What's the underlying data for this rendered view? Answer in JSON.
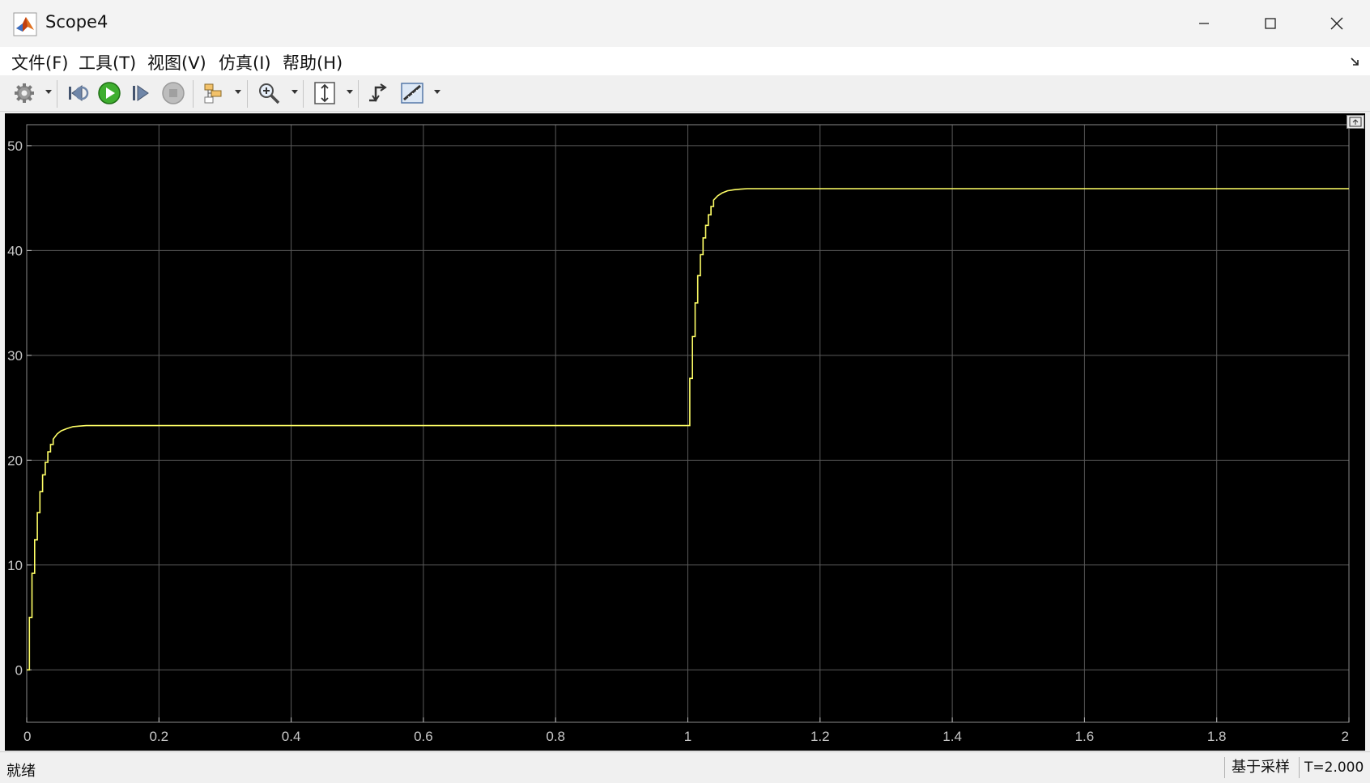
{
  "window": {
    "title": "Scope4",
    "menu": [
      "文件(F)",
      "工具(T)",
      "视图(V)",
      "仿真(I)",
      "帮助(H)"
    ]
  },
  "toolbar": {
    "icons": [
      "gear-icon",
      "step-back-icon",
      "run-icon",
      "step-forward-icon",
      "stop-icon",
      "signal-selector-icon",
      "zoom-icon",
      "autoscale-icon",
      "cursor-icon",
      "measurements-icon"
    ]
  },
  "status": {
    "text": "就绪",
    "sample_mode": "基于采样",
    "time": "T=2.000"
  },
  "colors": {
    "plot_background": "#000000",
    "axes_background": "#000000",
    "signal": "#ffff66",
    "grid": "#5a5a5a",
    "tick_text": "#c8c8c8"
  },
  "chart_data": {
    "type": "line",
    "xlim": [
      0,
      2
    ],
    "ylim": [
      -5,
      52
    ],
    "xticks": [
      "0",
      "0.2",
      "0.4",
      "0.6",
      "0.8",
      "1",
      "1.2",
      "1.4",
      "1.6",
      "1.8",
      "2"
    ],
    "xtick_values": [
      0,
      0.2,
      0.4,
      0.6,
      0.8,
      1,
      1.2,
      1.4,
      1.6,
      1.8,
      2
    ],
    "yticks": [
      "0",
      "10",
      "20",
      "30",
      "40",
      "50"
    ],
    "ytick_values": [
      0,
      10,
      20,
      30,
      40,
      50
    ],
    "grid": true,
    "series": [
      {
        "x": [
          0,
          0.004,
          0.004,
          0.008,
          0.008,
          0.012,
          0.012,
          0.016,
          0.016,
          0.02,
          0.02,
          0.024,
          0.024,
          0.028,
          0.028,
          0.032,
          0.032,
          0.036,
          0.036,
          0.04,
          0.04,
          0.046,
          0.052,
          0.06,
          0.07,
          0.08,
          0.09,
          0.1,
          1.003,
          1.003,
          1.007,
          1.007,
          1.011,
          1.011,
          1.015,
          1.015,
          1.019,
          1.019,
          1.023,
          1.023,
          1.027,
          1.027,
          1.031,
          1.031,
          1.035,
          1.035,
          1.039,
          1.039,
          1.045,
          1.052,
          1.06,
          1.07,
          1.08,
          1.09,
          1.1,
          2.0
        ],
        "y": [
          0,
          0,
          5.0,
          5.0,
          9.2,
          9.2,
          12.4,
          12.4,
          15.0,
          15.0,
          17.0,
          17.0,
          18.6,
          18.6,
          19.8,
          19.8,
          20.8,
          20.8,
          21.5,
          21.5,
          22.0,
          22.5,
          22.8,
          23.0,
          23.2,
          23.25,
          23.3,
          23.3,
          23.3,
          27.8,
          27.8,
          31.8,
          31.8,
          35.0,
          35.0,
          37.6,
          37.6,
          39.6,
          39.6,
          41.2,
          41.2,
          42.4,
          42.4,
          43.4,
          43.4,
          44.2,
          44.2,
          44.8,
          45.2,
          45.5,
          45.7,
          45.8,
          45.85,
          45.9,
          45.9,
          45.9
        ]
      }
    ]
  }
}
